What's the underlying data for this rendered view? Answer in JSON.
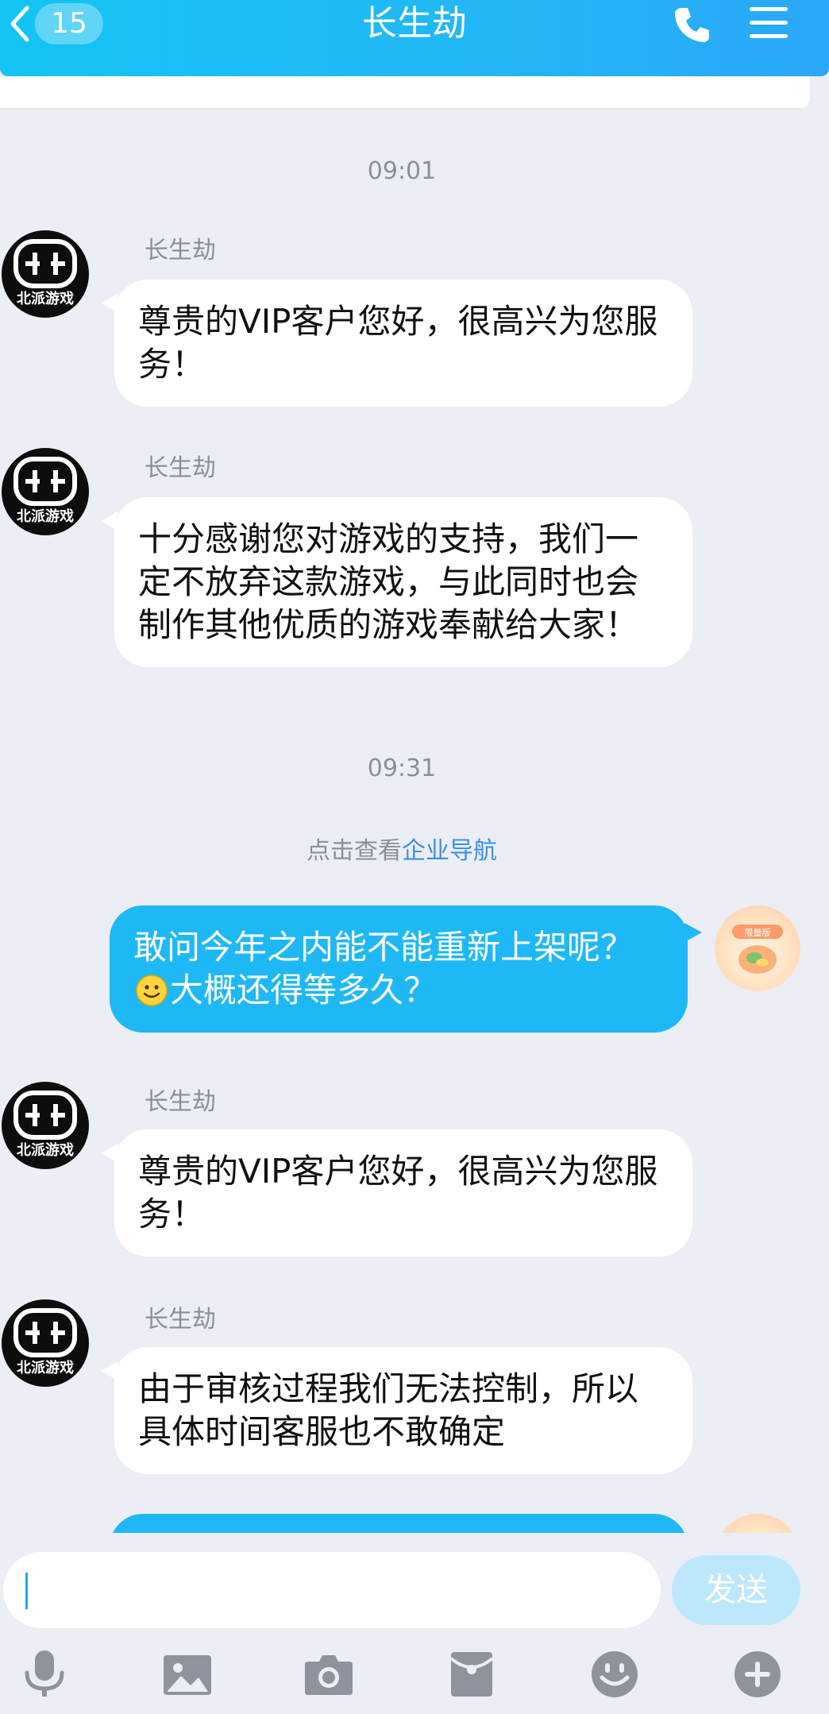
{
  "header": {
    "unread_count": "15",
    "title": "长生劫"
  },
  "messages": {
    "time_1": "09:01",
    "m1": {
      "sender": "长生劫",
      "text": "尊贵的VIP客户您好，很高兴为您服务！"
    },
    "m2": {
      "sender": "长生劫",
      "text": "十分感谢您对游戏的支持，我们一定不放弃这款游戏，与此同时也会制作其他优质的游戏奉献给大家！"
    },
    "time_2": "09:31",
    "system": {
      "prefix": "点击查看",
      "link": "企业导航"
    },
    "m3": {
      "text_before_emoji": "敢问今年之内能不能重新上架呢？",
      "emoji": "smile-emoji",
      "text_after_emoji": "大概还得等多久？"
    },
    "m4": {
      "sender": "长生劫",
      "text": "尊贵的VIP客户您好，很高兴为您服务！"
    },
    "m5": {
      "sender": "长生劫",
      "text": "由于审核过程我们无法控制，所以具体时间客服也不敢确定"
    }
  },
  "avatars": {
    "brand_text": "北派游戏",
    "user_label": "限量版"
  },
  "input": {
    "value": "",
    "placeholder": "",
    "send_label": "发送"
  },
  "toolbar": {
    "icons": [
      "microphone-icon",
      "image-icon",
      "camera-icon",
      "red-packet-icon",
      "emoji-icon",
      "plus-icon"
    ]
  },
  "colors": {
    "header_start": "#14c4f4",
    "header_end": "#2aa8f8",
    "outgoing_bubble": "#1fb8f6",
    "incoming_bubble": "#ffffff",
    "background": "#eceef5",
    "link": "#3b8fe6",
    "send_button_disabled": "#bde8fb"
  }
}
